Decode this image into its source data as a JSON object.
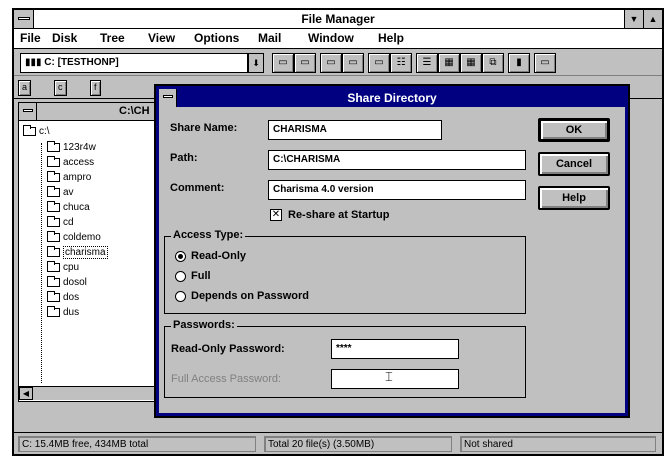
{
  "window": {
    "title": "File Manager",
    "min_glyph": "▼",
    "max_glyph": "▲"
  },
  "menu": {
    "items": [
      "File",
      "Disk",
      "Tree",
      "View",
      "Options",
      "Mail",
      "Window",
      "Help"
    ]
  },
  "toolbar": {
    "drive_value": "▮▮▮ C: [TESTHONP]",
    "dropdown_glyph": "⬇",
    "buttons": [
      "▭",
      "▭",
      "▭",
      "▭",
      "▭",
      "☷",
      "☰",
      "▦",
      "▦",
      "⧉",
      "▮",
      "▭"
    ]
  },
  "drivebar": {
    "drives": [
      "a",
      "c",
      "f"
    ]
  },
  "tree": {
    "title": "C:\\CH",
    "root": "c:\\",
    "items": [
      "123r4w",
      "access",
      "ampro",
      "av",
      "chuca",
      "cd",
      "coldemo",
      "charisma",
      "cpu",
      "dosol",
      "dos",
      "dus"
    ],
    "selected_index": 7
  },
  "status": {
    "free": "C: 15.4MB free, 434MB total",
    "total": "Total 20 file(s) (3.50MB)",
    "shared": "Not shared"
  },
  "dialog": {
    "title": "Share Directory",
    "share_name_label": "Share Name:",
    "share_name_value": "CHARISMA",
    "path_label": "Path:",
    "path_value": "C:\\CHARISMA",
    "comment_label": "Comment:",
    "comment_value": "Charisma 4.0 version",
    "reshare_label": "Re-share at Startup",
    "reshare_checked": true,
    "ok_label": "OK",
    "cancel_label": "Cancel",
    "help_label": "Help",
    "access": {
      "title": "Access Type:",
      "options": [
        "Read-Only",
        "Full",
        "Depends on Password"
      ],
      "selected": "Read-Only"
    },
    "passwords": {
      "title": "Passwords:",
      "readonly_label": "Read-Only Password:",
      "readonly_value": "****",
      "full_label": "Full Access Password:",
      "full_value": ""
    }
  }
}
